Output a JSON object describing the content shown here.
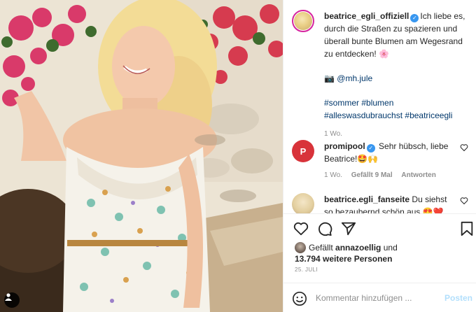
{
  "post": {
    "author": "beatrice_egli_offiziell",
    "caption": "Ich liebe es, durch die Straßen zu spazieren und überall bunte Blumen am Wegesrand zu entdecken! 🌸",
    "camera_emoji": "📷",
    "credit": "@mh.jule",
    "hashtags_line1": "#sommer #blumen",
    "hashtags_line2": "#alleswasdubrauchst #beatriceegli",
    "age": "1 Wo."
  },
  "comments": [
    {
      "avatar_text": "P",
      "username": "promipool",
      "verified": true,
      "text": "Sehr hübsch, liebe Beatrice!🤩🙌",
      "age": "1 Wo.",
      "likes": "Gefällt 9 Mal",
      "reply": "Antworten"
    },
    {
      "username": "beatrice.egli_fanseite",
      "text": "Du siehst so bezaubernd schön aus 😍❤️"
    }
  ],
  "likes": {
    "prefix": "Gefällt",
    "user": "annazoellig",
    "connector": "und",
    "others": "13.794 weitere Personen"
  },
  "date": "25. JULI",
  "comment_input": {
    "placeholder": "Kommentar hinzufügen ..."
  },
  "post_button": "Posten",
  "icons": [
    "user-tag-icon",
    "verified-icon",
    "heart-icon",
    "comment-icon",
    "share-icon",
    "bookmark-icon",
    "emoji-icon"
  ],
  "colors": {
    "link": "#00376b",
    "verified": "#3897f0",
    "post_button": "#b2dffc",
    "muted": "#8e8e8e"
  }
}
